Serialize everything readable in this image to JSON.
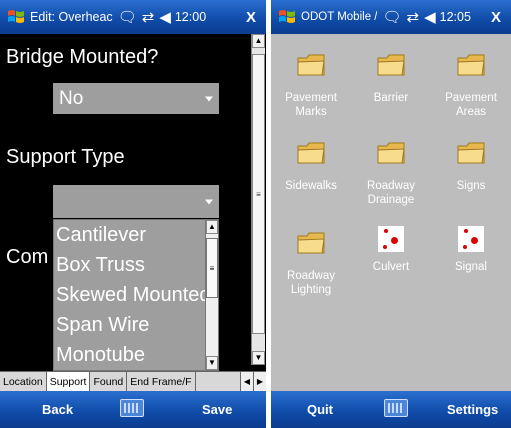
{
  "left": {
    "title": "Edit: Overheac",
    "time": "12:00",
    "close_label": "X",
    "bridge_label": "Bridge Mounted?",
    "bridge_value": "No",
    "support_label": "Support Type",
    "support_value": "",
    "comments_label": "Com",
    "dropdown_options": [
      "Cantilever",
      "Box Truss",
      "Skewed Mounted",
      "Span Wire",
      "Monotube"
    ],
    "tabs": [
      "Location",
      "Support",
      "Found",
      "End Frame/F"
    ],
    "active_tab": "Support",
    "softkey_left": "Back",
    "softkey_right": "Save",
    "icons": [
      "windows-flag-icon",
      "chat-bubble-icon",
      "connectivity-arrows-icon",
      "speaker-icon",
      "keyboard-icon"
    ]
  },
  "right": {
    "title": "ODOT Mobile /",
    "time": "12:05",
    "close_label": "X",
    "items": [
      {
        "label": "Pavement Marks",
        "icon": "folder-icon"
      },
      {
        "label": "Barrier",
        "icon": "folder-icon"
      },
      {
        "label": "Pavement Areas",
        "icon": "folder-icon"
      },
      {
        "label": "Sidewalks",
        "icon": "folder-icon"
      },
      {
        "label": "Roadway Drainage",
        "icon": "folder-icon"
      },
      {
        "label": "Signs",
        "icon": "folder-icon"
      },
      {
        "label": "Roadway Lighting",
        "icon": "folder-icon"
      },
      {
        "label": "Culvert",
        "icon": "red-dots-icon"
      },
      {
        "label": "Signal",
        "icon": "red-dots-icon"
      }
    ],
    "softkey_left": "Quit",
    "softkey_right": "Settings"
  },
  "colors": {
    "titlebar": "#0f4aa6",
    "left_background": "#000000",
    "right_background": "#bdbdbd",
    "field_gray": "#9e9e9e",
    "folder_yellow": "#f2d27a",
    "dot_red": "#dd0000"
  }
}
